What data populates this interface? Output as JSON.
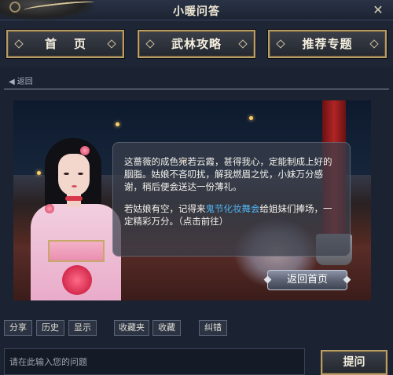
{
  "window": {
    "title": "小暖问答",
    "close_glyph": "✕"
  },
  "nav": {
    "home_label": "首页",
    "guide_label": "武林攻略",
    "topics_label": "推荐专题"
  },
  "back": {
    "label": "返回",
    "arrow_glyph": "◀"
  },
  "dialog": {
    "paragraph1": "这蔷薇的成色宛若云霞，甚得我心，定能制成上好的胭脂。姑娘不吝叨扰，解我燃眉之忧，小妹万分感谢，稍后便会送达一份薄礼。",
    "paragraph2_before": "若姑娘有空，记得来",
    "paragraph2_link": "鬼节化妆舞会",
    "paragraph2_after": "给姐妹们捧场，一定精彩万分。（点击前往）"
  },
  "return_home_label": "返回首页",
  "toolbar": {
    "share": "分享",
    "history": "历史",
    "display": "显示",
    "favorites_folder": "收藏夹",
    "favorite": "收藏",
    "correct": "纠错"
  },
  "question": {
    "placeholder": "请在此输入您的问题",
    "value": ""
  },
  "ask_label": "提问",
  "colors": {
    "accent_gold": "#b79e6a",
    "link_blue": "#4fb3f0",
    "background": "#1b2231"
  }
}
